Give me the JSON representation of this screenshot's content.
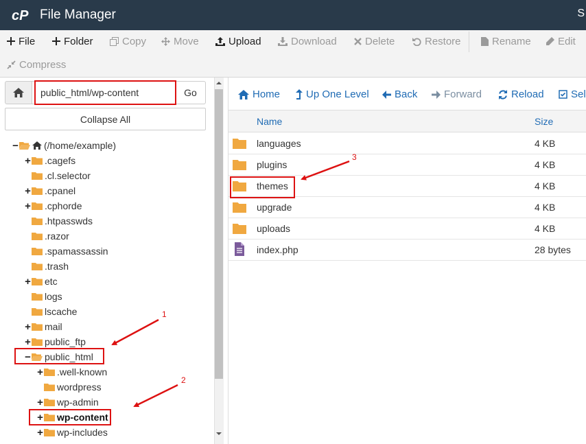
{
  "header": {
    "title": "File Manager",
    "right_text": "S"
  },
  "colors": {
    "header_bg": "#293a4a",
    "link": "#1f6bb4",
    "folder": "#f0a840",
    "annotation": "#dd1111"
  },
  "toolbar": {
    "file": "File",
    "folder": "Folder",
    "copy": "Copy",
    "move": "Move",
    "upload": "Upload",
    "download": "Download",
    "delete": "Delete",
    "restore": "Restore",
    "rename": "Rename",
    "edit": "Edit",
    "compress": "Compress"
  },
  "left": {
    "path_value": "public_html/wp-content",
    "go_label": "Go",
    "collapse_label": "Collapse All",
    "tree": [
      {
        "label": "(/home/example)",
        "toggle": "−",
        "open": true,
        "bold": false
      },
      {
        "label": ".cagefs",
        "toggle": "+",
        "open": false,
        "bold": false
      },
      {
        "label": ".cl.selector",
        "toggle": "",
        "open": false,
        "bold": false
      },
      {
        "label": ".cpanel",
        "toggle": "+",
        "open": false,
        "bold": false
      },
      {
        "label": ".cphorde",
        "toggle": "+",
        "open": false,
        "bold": false
      },
      {
        "label": ".htpasswds",
        "toggle": "",
        "open": false,
        "bold": false
      },
      {
        "label": ".razor",
        "toggle": "",
        "open": false,
        "bold": false
      },
      {
        "label": ".spamassassin",
        "toggle": "",
        "open": false,
        "bold": false
      },
      {
        "label": ".trash",
        "toggle": "",
        "open": false,
        "bold": false
      },
      {
        "label": "etc",
        "toggle": "+",
        "open": false,
        "bold": false
      },
      {
        "label": "logs",
        "toggle": "",
        "open": false,
        "bold": false
      },
      {
        "label": "lscache",
        "toggle": "",
        "open": false,
        "bold": false
      },
      {
        "label": "mail",
        "toggle": "+",
        "open": false,
        "bold": false
      },
      {
        "label": "public_ftp",
        "toggle": "+",
        "open": false,
        "bold": false
      },
      {
        "label": "public_html",
        "toggle": "−",
        "open": true,
        "bold": false
      },
      {
        "label": ".well-known",
        "toggle": "+",
        "open": false,
        "bold": false
      },
      {
        "label": "wordpress",
        "toggle": "",
        "open": false,
        "bold": false
      },
      {
        "label": "wp-admin",
        "toggle": "+",
        "open": false,
        "bold": false
      },
      {
        "label": "wp-content",
        "toggle": "+",
        "open": false,
        "bold": true
      },
      {
        "label": "wp-includes",
        "toggle": "+",
        "open": false,
        "bold": false
      }
    ]
  },
  "nav": {
    "home": "Home",
    "up": "Up One Level",
    "back": "Back",
    "forward": "Forward",
    "reload": "Reload",
    "select": "Sele"
  },
  "table": {
    "col_name": "Name",
    "col_size": "Size",
    "rows": [
      {
        "name": "languages",
        "size": "4 KB",
        "type": "folder"
      },
      {
        "name": "plugins",
        "size": "4 KB",
        "type": "folder"
      },
      {
        "name": "themes",
        "size": "4 KB",
        "type": "folder"
      },
      {
        "name": "upgrade",
        "size": "4 KB",
        "type": "folder"
      },
      {
        "name": "uploads",
        "size": "4 KB",
        "type": "folder"
      },
      {
        "name": "index.php",
        "size": "28 bytes",
        "type": "file"
      }
    ]
  },
  "annotations": {
    "n1": "1",
    "n2": "2",
    "n3": "3"
  }
}
